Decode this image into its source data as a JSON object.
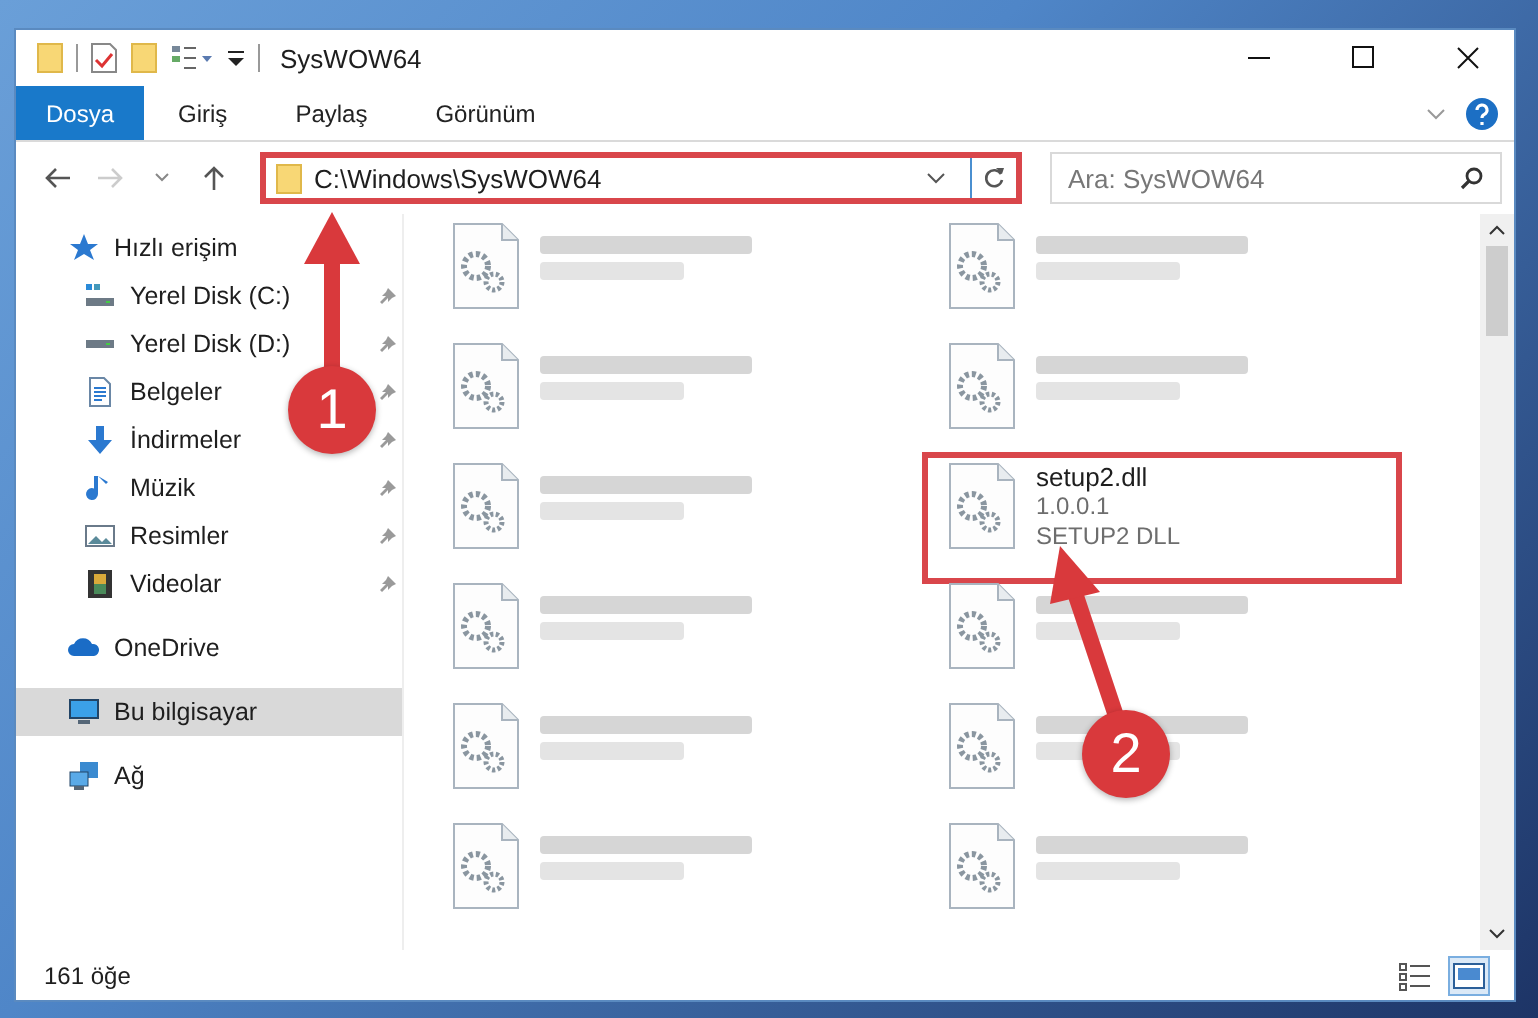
{
  "window": {
    "title": "SysWOW64"
  },
  "ribbon_tabs": [
    {
      "label": "Dosya",
      "selected": true
    },
    {
      "label": "Giriş",
      "selected": false
    },
    {
      "label": "Paylaş",
      "selected": false
    },
    {
      "label": "Görünüm",
      "selected": false
    }
  ],
  "navigation": {
    "back_disabled": false,
    "forward_disabled": true
  },
  "address_bar": {
    "value": "C:\\Windows\\SysWOW64",
    "highlighted": true
  },
  "search": {
    "placeholder": "Ara: SysWOW64"
  },
  "sidebar": {
    "items": [
      {
        "label": "Hızlı erişim",
        "kind": "star",
        "selected": false,
        "children": [
          {
            "label": "Yerel Disk (C:)",
            "kind": "drive-c",
            "pinned": true
          },
          {
            "label": "Yerel Disk (D:)",
            "kind": "drive",
            "pinned": true
          },
          {
            "label": "Belgeler",
            "kind": "documents",
            "pinned": true
          },
          {
            "label": "İndirmeler",
            "kind": "downloads",
            "pinned": true
          },
          {
            "label": "Müzik",
            "kind": "music",
            "pinned": true
          },
          {
            "label": "Resimler",
            "kind": "pictures",
            "pinned": true
          },
          {
            "label": "Videolar",
            "kind": "videos",
            "pinned": true
          }
        ]
      },
      {
        "label": "OneDrive",
        "kind": "cloud",
        "selected": false
      },
      {
        "label": "Bu bilgisayar",
        "kind": "computer",
        "selected": true
      },
      {
        "label": "Ağ",
        "kind": "network",
        "selected": false
      }
    ]
  },
  "files": [
    {
      "kind": "blurred"
    },
    {
      "kind": "blurred"
    },
    {
      "kind": "blurred"
    },
    {
      "kind": "blurred"
    },
    {
      "kind": "blurred"
    },
    {
      "kind": "file",
      "name": "setup2.dll",
      "details": [
        "1.0.0.1",
        "SETUP2 DLL"
      ],
      "highlighted": true
    },
    {
      "kind": "blurred"
    },
    {
      "kind": "blurred"
    },
    {
      "kind": "blurred"
    },
    {
      "kind": "blurred"
    },
    {
      "kind": "blurred"
    },
    {
      "kind": "blurred"
    }
  ],
  "status_bar": {
    "count": "161 öğe",
    "views": [
      {
        "kind": "details",
        "selected": false
      },
      {
        "kind": "tiles",
        "selected": true
      }
    ]
  },
  "annotations": [
    {
      "label": "1"
    },
    {
      "label": "2"
    }
  ]
}
